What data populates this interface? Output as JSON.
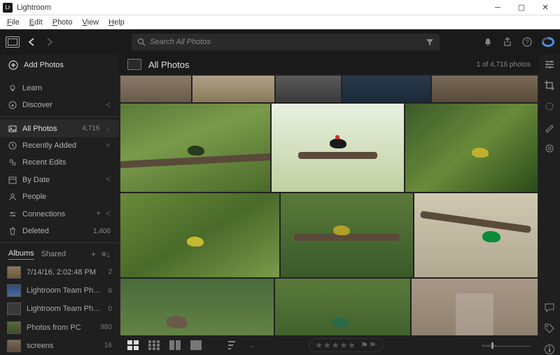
{
  "window": {
    "title": "Lightroom"
  },
  "menu": [
    "File",
    "Edit",
    "Photo",
    "View",
    "Help"
  ],
  "toolbar": {
    "search_placeholder": "Search All Photos"
  },
  "sidebar": {
    "add": "Add Photos",
    "learn": "Learn",
    "discover": "Discover",
    "nav": [
      {
        "icon": "all",
        "label": "All Photos",
        "count": "4,716",
        "sel": true,
        "chev": true
      },
      {
        "icon": "recent",
        "label": "Recently Added",
        "chev": true
      },
      {
        "icon": "edits",
        "label": "Recent Edits"
      },
      {
        "icon": "date",
        "label": "By Date",
        "chev": true
      },
      {
        "icon": "people",
        "label": "People"
      },
      {
        "icon": "conn",
        "label": "Connections",
        "plus": true,
        "chev": true
      },
      {
        "icon": "trash",
        "label": "Deleted",
        "count": "1,406"
      }
    ],
    "tabs": {
      "albums": "Albums",
      "shared": "Shared"
    },
    "albums": [
      {
        "label": "7/14/16, 2:02:48 PM",
        "count": "2"
      },
      {
        "label": "Lightroom Team Photos",
        "count": "6"
      },
      {
        "label": "Lightroom Team Photos",
        "count": "0"
      },
      {
        "label": "Photos from PC",
        "count": "980"
      },
      {
        "label": "screens",
        "count": "16"
      }
    ]
  },
  "main": {
    "title": "All Photos",
    "count": "1 of 4,716 photos"
  },
  "footer": {
    "stars": "★ ★ ★ ★ ★"
  }
}
